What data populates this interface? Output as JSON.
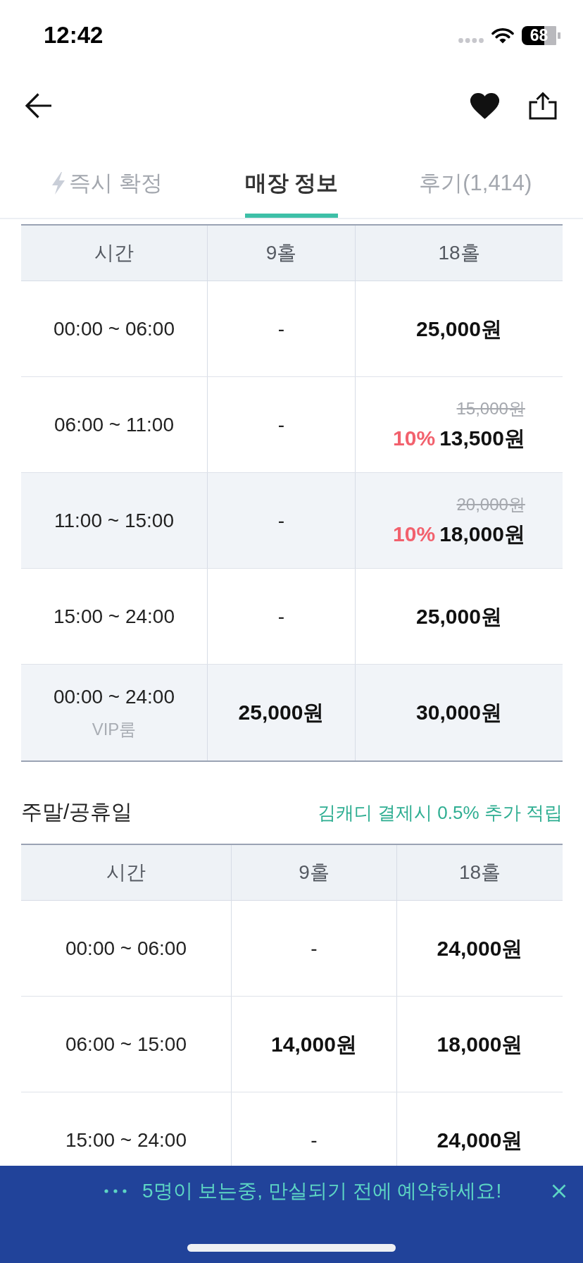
{
  "status_bar": {
    "time": "12:42",
    "battery": "68"
  },
  "header": {
    "favorited": true
  },
  "tabs": [
    {
      "label": "즉시 확정",
      "kind": "instant",
      "selected": false
    },
    {
      "label": "매장 정보",
      "kind": "plain",
      "selected": true
    },
    {
      "label": "후기(1,414)",
      "kind": "plain",
      "selected": false
    }
  ],
  "weekday_table": {
    "columns": [
      "시간",
      "9홀",
      "18홀"
    ],
    "rows": [
      {
        "highlighted": false,
        "cells": [
          {
            "kind": "time",
            "text": "00:00 ~ 06:00"
          },
          {
            "kind": "empty",
            "text": "-"
          },
          {
            "kind": "price",
            "text": "25,000원"
          }
        ]
      },
      {
        "highlighted": false,
        "cells": [
          {
            "kind": "time",
            "text": "06:00 ~ 11:00"
          },
          {
            "kind": "empty",
            "text": "-"
          },
          {
            "kind": "discount",
            "original": "15,000원",
            "rate": "10%",
            "text": "13,500원"
          }
        ]
      },
      {
        "highlighted": true,
        "cells": [
          {
            "kind": "time",
            "text": "11:00 ~ 15:00"
          },
          {
            "kind": "empty",
            "text": "-"
          },
          {
            "kind": "discount",
            "original": "20,000원",
            "rate": "10%",
            "text": "18,000원"
          }
        ]
      },
      {
        "highlighted": false,
        "cells": [
          {
            "kind": "time",
            "text": "15:00 ~ 24:00"
          },
          {
            "kind": "empty",
            "text": "-"
          },
          {
            "kind": "price",
            "text": "25,000원"
          }
        ]
      },
      {
        "highlighted": true,
        "cells": [
          {
            "kind": "time",
            "text": "00:00 ~ 24:00",
            "note": "VIP룸"
          },
          {
            "kind": "price",
            "text": "25,000원"
          },
          {
            "kind": "price",
            "text": "30,000원"
          }
        ]
      }
    ]
  },
  "weekend_table": {
    "title": "주말/공휴일",
    "note": "김캐디 결제시 0.5% 추가 적립",
    "columns": [
      "시간",
      "9홀",
      "18홀"
    ],
    "rows": [
      {
        "highlighted": false,
        "cells": [
          {
            "kind": "time",
            "text": "00:00 ~ 06:00"
          },
          {
            "kind": "empty",
            "text": "-"
          },
          {
            "kind": "price",
            "text": "24,000원"
          }
        ]
      },
      {
        "highlighted": false,
        "cells": [
          {
            "kind": "time",
            "text": "06:00 ~ 15:00"
          },
          {
            "kind": "price",
            "text": "14,000원"
          },
          {
            "kind": "price",
            "text": "18,000원"
          }
        ]
      },
      {
        "highlighted": false,
        "cells": [
          {
            "kind": "time",
            "text": "15:00 ~ 24:00"
          },
          {
            "kind": "empty",
            "text": "-"
          },
          {
            "kind": "price",
            "text": "24,000원"
          }
        ]
      }
    ]
  },
  "banner": {
    "message": "5명이 보는중, 만실되기 전에 예약하세요!"
  }
}
